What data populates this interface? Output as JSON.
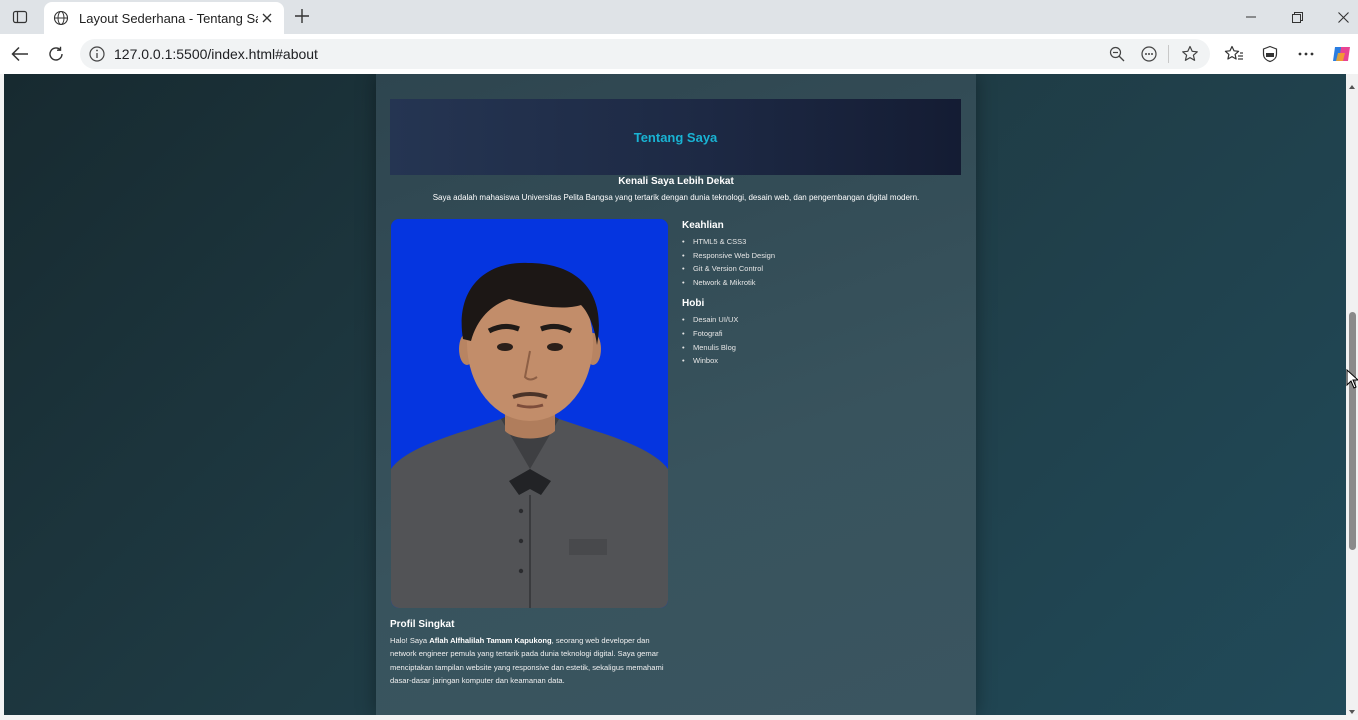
{
  "browser": {
    "tab_title": "Layout Sederhana - Tentang Saya",
    "url": "127.0.0.1:5500/index.html#about",
    "icons": [
      "tab-actions-icon",
      "globe-icon",
      "close-icon",
      "plus-icon",
      "minimize-icon",
      "restore-icon",
      "window-close-icon",
      "back-icon",
      "reload-icon",
      "info-icon",
      "zoom-out-icon",
      "read-aloud-icon",
      "favorite-star-icon",
      "favorites-icon",
      "browser-essentials-icon",
      "more-icon",
      "copilot-icon"
    ]
  },
  "page": {
    "hero_title": "Tentang Saya",
    "subtitle": "Kenali Saya Lebih Dekat",
    "intro": "Saya adalah mahasiswa Universitas Pelita Bangsa yang tertarik dengan dunia teknologi, desain web, dan pengembangan digital modern.",
    "skills_heading": "Keahlian",
    "skills": [
      "HTML5 & CSS3",
      "Responsive Web Design",
      "Git & Version Control",
      "Network & Mikrotik"
    ],
    "hobbies_heading": "Hobi",
    "hobbies": [
      "Desain UI/UX",
      "Fotografi",
      "Menulis Blog",
      "Winbox"
    ],
    "profile_heading": "Profil Singkat",
    "profile_prefix": "Halo! Saya ",
    "profile_name": "Aflah Alfhalilah Tamam Kapukong",
    "profile_suffix": ", seorang web developer dan network engineer pemula yang tertarik pada dunia teknologi digital. Saya gemar menciptakan tampilan website yang responsive dan estetik, sekaligus memahami dasar-dasar jaringan komputer dan keamanan data."
  },
  "colors": {
    "accent": "#19b3d3",
    "photo_background": "#0535e0"
  }
}
